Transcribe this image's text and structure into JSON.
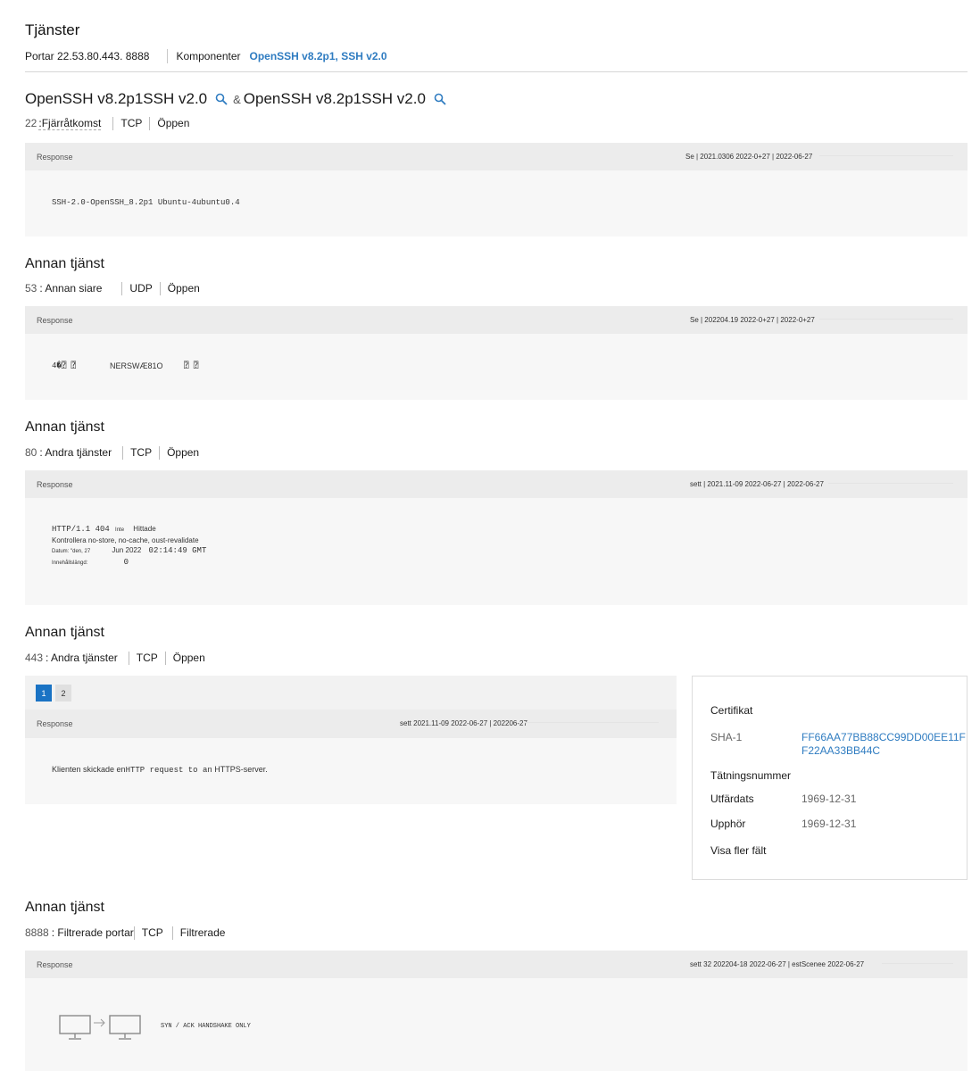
{
  "header": {
    "title": "Tjänster",
    "ports": "Portar 22.53.80.443. 8888",
    "components_label": "Komponenter",
    "components_value": "OpenSSH v8.2p1, SSH v2.0"
  },
  "services": [
    {
      "title_a": "OpenSSH v8.2p1SSH v2.0",
      "amp": "&",
      "title_b": "OpenSSH v8.2p1SSH v2.0",
      "port": "22",
      "port_name": ":Fjärråtkomst",
      "protocol": "TCP",
      "state": "Öppen",
      "response_label": "Response",
      "seen": "Se | 2021.0306 2022-0+27 | 2022-06-27",
      "response_text": "SSH-2.0-OpenSSH_8.2p1 Ubuntu-4ubuntu0.4"
    },
    {
      "title": "Annan tjänst",
      "port": "53",
      "port_name": ": Annan siare",
      "protocol": "UDP",
      "state": "Öppen",
      "response_label": "Response",
      "seen": "Se | 202204.19 2022-0+27 | 2022-0+27",
      "response_a": "4�⍰ ⍰",
      "response_b": "NERSWÆ81O",
      "response_c": "⍰ ⍰"
    },
    {
      "title": "Annan tjänst",
      "port": "80",
      "port_name": ": Andra tjänster",
      "protocol": "TCP",
      "state": "Öppen",
      "response_label": "Response",
      "seen": "sett | 2021.11-09 2022-06-27 | 2022-06-27",
      "line1_code": "HTTP/1.1 404",
      "line1_small": "Inte",
      "line1_word": "Hittade",
      "line2": "Kontrollera no-store, no-cache, oust-revalidate",
      "line3_label": "Datum: \"den, 27",
      "line3_mid": "Jun 2022",
      "line3_code": "02:14:49 GMT",
      "line4_label": "Innehållslängd:",
      "line4_code": "0"
    },
    {
      "title": "Annan tjänst",
      "port": "443",
      "port_name": ": Andra tjänster",
      "protocol": "TCP",
      "state": "Öppen",
      "pages": [
        "1",
        "2"
      ],
      "response_label": "Response",
      "seen": "sett 2021.11-09 2022-06-27 | 202206-27",
      "resp_pre": "Klienten skickade en",
      "resp_code": "HTTP request to an",
      "resp_post": "HTTPS-server."
    },
    {
      "title": "Annan tjänst",
      "port": "8888",
      "port_name": ": Filtrerade portar",
      "protocol": "TCP",
      "state": "Filtrerade",
      "response_label": "Response",
      "seen": "sett 32 202204-18 2022-06-27 | estScenee 2022-06-27",
      "handshake": "SYN / ACK HANDSHAKE ONLY"
    }
  ],
  "certificate": {
    "title": "Certifikat",
    "sha_label": "SHA-1",
    "sha_line1": "FF66AA77BB88CC99DD00EE11F",
    "sha_line2": "F22AA33BB44C",
    "serial_label": "Tätningsnummer",
    "issued_label": "Utfärdats",
    "issued_value": "1969-12-31",
    "expires_label": "Upphör",
    "expires_value": "1969-12-31",
    "more_fields": "Visa fler fält"
  },
  "colors": {
    "link": "#2f7cc1",
    "pager_active": "#1a73c4",
    "response_bg": "#f7f7f7",
    "response_head": "#ececec"
  },
  "icons": [
    "search-icon",
    "monitor-icon",
    "arrow-right-icon"
  ]
}
